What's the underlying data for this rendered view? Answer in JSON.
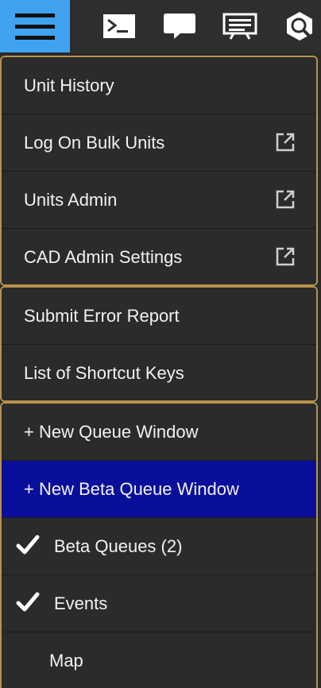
{
  "toolbar": {
    "icons": [
      "hamburger-menu-icon",
      "terminal-icon",
      "chat-icon",
      "message-board-icon",
      "search-gear-icon"
    ],
    "accent": "#3fa3f2"
  },
  "menu": {
    "border_color": "#b7924c",
    "active_color": "#0a0f9b",
    "groups": [
      {
        "items": [
          {
            "label": "Unit History",
            "external": false
          },
          {
            "label": "Log On Bulk Units",
            "external": true
          },
          {
            "label": "Units Admin",
            "external": true
          },
          {
            "label": "CAD Admin Settings",
            "external": true
          }
        ]
      },
      {
        "items": [
          {
            "label": "Submit Error Report"
          },
          {
            "label": "List of Shortcut Keys"
          }
        ]
      },
      {
        "items": [
          {
            "label": "+ New Queue Window",
            "active": false
          },
          {
            "label": "+ New Beta Queue Window",
            "active": true
          },
          {
            "label": "Beta Queues (2)",
            "checked": true
          },
          {
            "label": "Events",
            "checked": true
          },
          {
            "label": "Map",
            "checked": false
          }
        ]
      }
    ]
  }
}
